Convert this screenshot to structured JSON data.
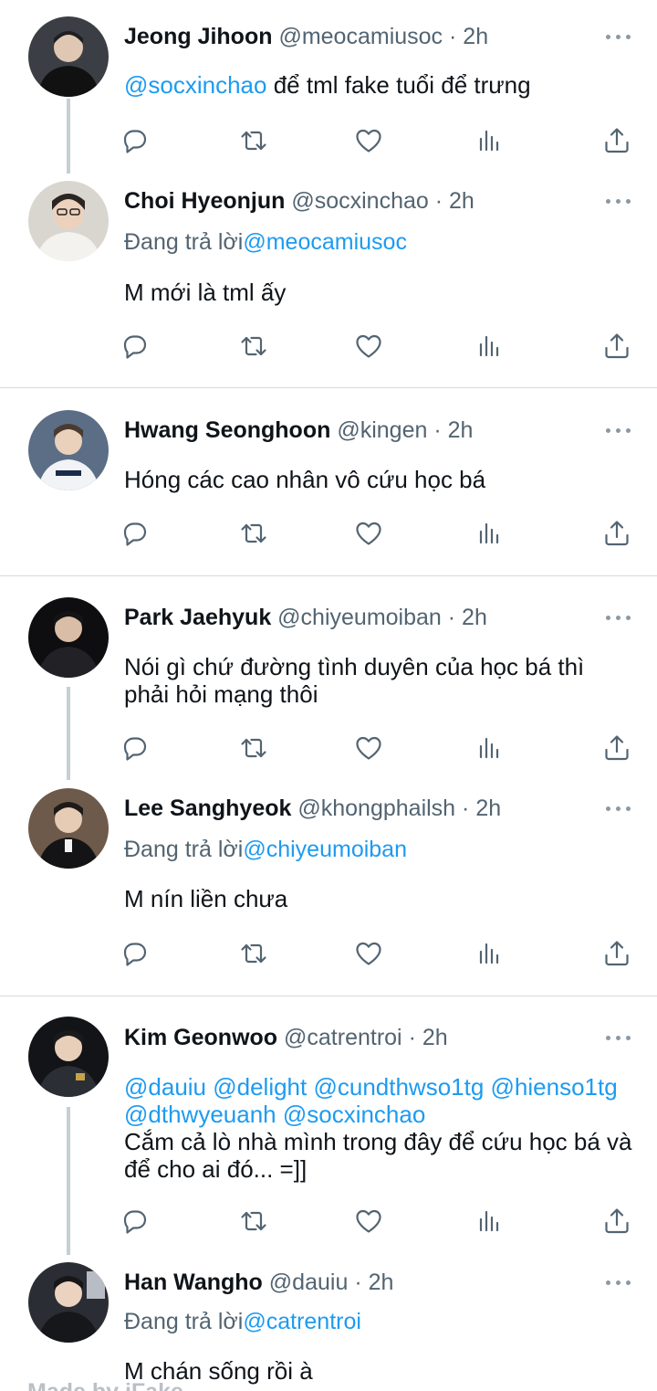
{
  "tweets": [
    {
      "name": "Jeong Jihoon",
      "handle": "@meocamiusoc",
      "time": "2h",
      "reply_prefix": "",
      "reply_to": "",
      "mentions": "@socxinchao",
      "text": "để tml fake tuổi để trưng",
      "avatar_icon": "avatar-photo"
    },
    {
      "name": "Choi Hyeonjun",
      "handle": "@socxinchao",
      "time": "2h",
      "reply_prefix": "Đang trả lời",
      "reply_to": "@meocamiusoc",
      "mentions": "",
      "text": "M mới là tml ấy",
      "avatar_icon": "avatar-photo"
    },
    {
      "name": "Hwang Seonghoon",
      "handle": "@kingen",
      "time": "2h",
      "reply_prefix": "",
      "reply_to": "",
      "mentions": "",
      "text": "Hóng các cao nhân vô cứu học bá",
      "avatar_icon": "avatar-photo"
    },
    {
      "name": "Park Jaehyuk",
      "handle": "@chiyeumoiban",
      "time": "2h",
      "reply_prefix": "",
      "reply_to": "",
      "mentions": "",
      "text": "Nói gì chứ đường tình duyên của học bá thì phải hỏi mạng thôi",
      "avatar_icon": "avatar-photo"
    },
    {
      "name": "Lee Sanghyeok",
      "handle": "@khongphailsh",
      "time": "2h",
      "reply_prefix": "Đang trả lời",
      "reply_to": "@chiyeumoiban",
      "mentions": "",
      "text": "M nín liền chưa",
      "avatar_icon": "avatar-photo"
    },
    {
      "name": "Kim Geonwoo",
      "handle": "@catrentroi",
      "time": "2h",
      "reply_prefix": "",
      "reply_to": "",
      "mentions": "@dauiu @delight @cundthwso1tg @hienso1tg @dthwyeuanh @socxinchao",
      "text": "Cắm cả lò nhà mình trong đây để cứu học bá và để cho ai đó... =]]",
      "avatar_icon": "avatar-photo"
    },
    {
      "name": "Han Wangho",
      "handle": "@dauiu",
      "time": "2h",
      "reply_prefix": "Đang trả lời",
      "reply_to": "@catrentroi",
      "mentions": "",
      "text": "M chán sống rồi à",
      "avatar_icon": "avatar-photo"
    }
  ],
  "separator": "·",
  "icons": {
    "more": "more-icon",
    "reply": "reply-icon",
    "retweet": "retweet-icon",
    "like": "like-icon",
    "views": "views-icon",
    "share": "share-icon"
  },
  "colors": {
    "mention": "#1d9bf0",
    "secondary_text": "#536471",
    "thread_line": "#c4cfd6"
  },
  "watermark": "Made by iFake"
}
